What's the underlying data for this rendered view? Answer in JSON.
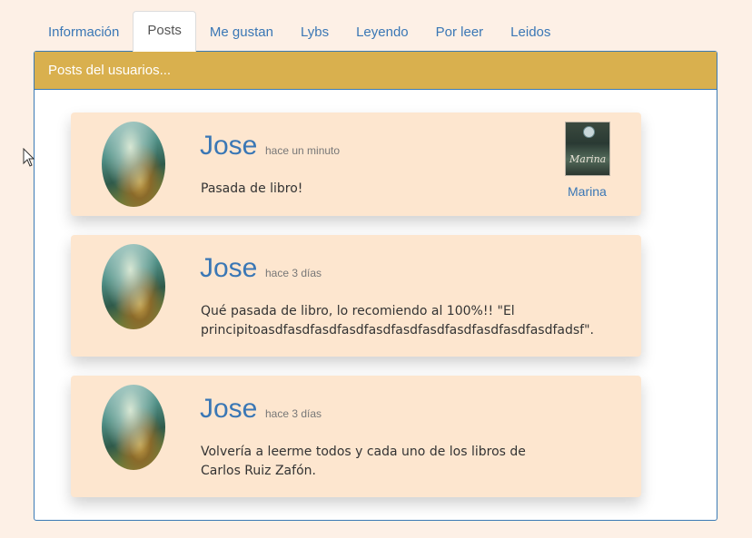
{
  "tabs": [
    {
      "label": "Información",
      "active": false
    },
    {
      "label": "Posts",
      "active": true
    },
    {
      "label": "Me gustan",
      "active": false
    },
    {
      "label": "Lybs",
      "active": false
    },
    {
      "label": "Leyendo",
      "active": false
    },
    {
      "label": "Por leer",
      "active": false
    },
    {
      "label": "Leidos",
      "active": false
    }
  ],
  "panel": {
    "heading": "Posts del usuarios..."
  },
  "posts": [
    {
      "user": "Jose",
      "time": "hace un minuto",
      "text_lines": [
        "Pasada de libro!"
      ],
      "book": {
        "title": "Marina",
        "cover_title": "Marina"
      }
    },
    {
      "user": "Jose",
      "time": "hace 3 días",
      "text_lines": [
        "Qué pasada de libro, lo recomiendo al 100%!! \"El",
        "principitoasdfasdfasdfasdfasdfasdfasdfasdfasdfasdfasdfadsf\"."
      ]
    },
    {
      "user": "Jose",
      "time": "hace 3 días",
      "text_lines": [
        "Volvería a leerme todos y cada uno de los libros de",
        "Carlos Ruiz Zafón."
      ]
    }
  ],
  "colors": {
    "background": "#fdf0e6",
    "link": "#3a77b5",
    "heading_bg": "#d9b04e",
    "post_bg": "#fde6cf"
  }
}
